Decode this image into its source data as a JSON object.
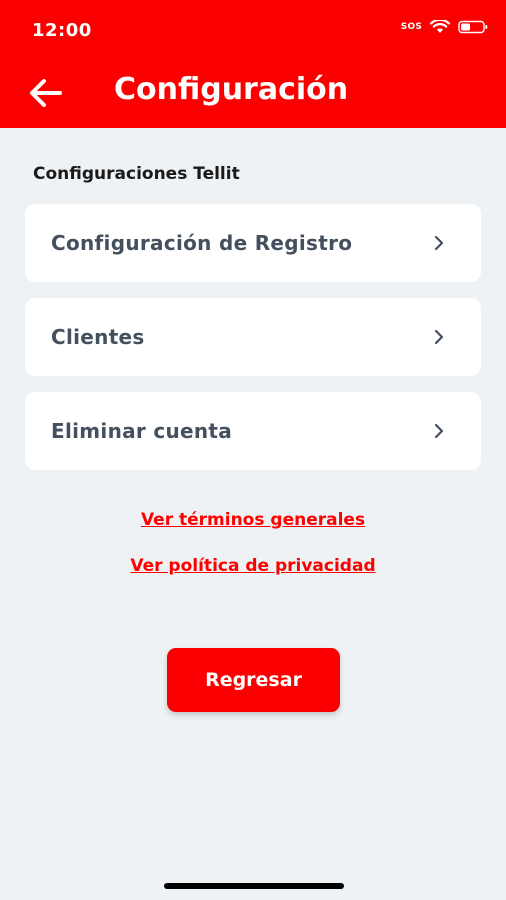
{
  "status_bar": {
    "time": "12:00",
    "sos": "SOS",
    "icons": [
      "wifi-icon",
      "battery-icon"
    ]
  },
  "header": {
    "title": "Configuración",
    "back_icon": "back-arrow-icon",
    "color": "#fb0000"
  },
  "section": {
    "label": "Configuraciones Tellit"
  },
  "menu": {
    "items": [
      {
        "label": "Configuración de Registro",
        "icon": "chevron-right-icon"
      },
      {
        "label": "Clientes",
        "icon": "chevron-right-icon"
      },
      {
        "label": "Eliminar cuenta",
        "icon": "chevron-right-icon"
      }
    ]
  },
  "links": {
    "terms": "Ver términos generales",
    "privacy": "Ver política de privacidad"
  },
  "actions": {
    "back_button": "Regresar"
  },
  "colors": {
    "accent": "#fb0000",
    "background": "#eff2f5",
    "card_text": "#45505e"
  }
}
